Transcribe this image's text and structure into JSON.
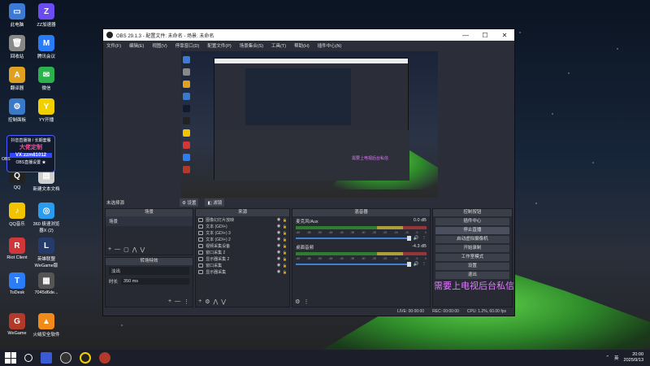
{
  "desktop": {
    "icons": [
      {
        "label": "此电脑",
        "color": "#3b7bd6",
        "glyph": "▭"
      },
      {
        "label": "ZZ加速器",
        "color": "#6b4cf0",
        "glyph": "Z"
      },
      {
        "label": "回收站",
        "color": "#888888",
        "glyph": "🗑"
      },
      {
        "label": "腾讯会议",
        "color": "#2a7cf6",
        "glyph": "M"
      },
      {
        "label": "翻译器",
        "color": "#e0a020",
        "glyph": "A"
      },
      {
        "label": "微信",
        "color": "#2bb24c",
        "glyph": "✉"
      },
      {
        "label": "控制面板",
        "color": "#3a78c8",
        "glyph": "⚙"
      },
      {
        "label": "YY开播",
        "color": "#f0d000",
        "glyph": "Y"
      },
      {
        "label": "QQ",
        "color": "#222222",
        "glyph": "Q"
      },
      {
        "label": "新建文本文档",
        "color": "#cfcfcf",
        "glyph": "▤"
      },
      {
        "label": "QQ音乐",
        "color": "#f2c400",
        "glyph": "♪"
      },
      {
        "label": "360 极速浏览器X (2)",
        "color": "#2a9cf0",
        "glyph": "◎"
      },
      {
        "label": "Riot Client",
        "color": "#d13639",
        "glyph": "R"
      },
      {
        "label": "英雄联盟 WeGame版",
        "color": "#243b6b",
        "glyph": "L"
      },
      {
        "label": "ToDesk",
        "color": "#2b7cf7",
        "glyph": "T"
      },
      {
        "label": "7045d6de...",
        "color": "#555555",
        "glyph": "▦"
      },
      {
        "label": "WeGame",
        "color": "#b33a2a",
        "glyph": "G"
      },
      {
        "label": "火绒安全软件",
        "color": "#f28a1a",
        "glyph": "▲"
      }
    ],
    "promo": {
      "line1": "抖音直播接 / 长期套餐",
      "line2": "大佬定制",
      "vx": "VX:zzm81012",
      "line3": "OBS直播设置 ★"
    },
    "obs_icon_label": "OBS"
  },
  "obs": {
    "title": "OBS 29.1.3 - 配置文件: 未命名 - 场景: 未命名",
    "window_controls": {
      "min": "—",
      "max": "☐",
      "close": "✕"
    },
    "menu": [
      "文件(F)",
      "编辑(E)",
      "视图(V)",
      "停靠窗口(D)",
      "配置文件(P)",
      "场景集合(S)",
      "工具(T)",
      "帮助(H)",
      "插件中心(N)"
    ],
    "preview_overlay_text": "需要上电视后台私信",
    "scene_bar": {
      "label": "未选择源",
      "settings": "⚙ 设置",
      "filters": "◧ 滤镜"
    },
    "docks": {
      "scenes": {
        "title": "场景",
        "items": [
          "场景"
        ],
        "footer": [
          "+",
          "—",
          "▢",
          "⋀",
          "⋁"
        ]
      },
      "transitions": {
        "title": "转场特效",
        "type": "淡出",
        "duration_label": "时长",
        "duration": "350 ms",
        "footer": [
          "+",
          "—",
          "⋮"
        ]
      },
      "sources": {
        "title": "来源",
        "items": [
          "图像幻灯片放映",
          "文本 (GDI+)",
          "文本 (GDI+) 3",
          "文本 (GDI+) 2",
          "视频采集设备",
          "窗口采集 2",
          "显示器采集 2",
          "窗口采集",
          "显示器采集"
        ],
        "footer": [
          "+",
          "⚙",
          "⋀",
          "⋁"
        ]
      },
      "mixer": {
        "title": "混音器",
        "channels": [
          {
            "name": "麦克风/Aux",
            "db": "0.0 dB"
          },
          {
            "name": "桌面音频",
            "db": "-4.3 dB"
          }
        ],
        "scale": [
          "-60",
          "-55",
          "-50",
          "-45",
          "-40",
          "-35",
          "-30",
          "-25",
          "-20",
          "-15",
          "-10",
          "-5",
          "0"
        ]
      },
      "controls": {
        "title": "控制按钮",
        "buttons": [
          "插件中心",
          "停止直播",
          "启动虚拟摄像机",
          "开始录制",
          "工作室模式",
          "设置",
          "退出"
        ]
      }
    },
    "status": {
      "live": "LIVE: 00:00:00",
      "rec": "REC: 00:00:00",
      "cpu": "CPU: 1.2%, 60.00 fps"
    }
  },
  "overlay_text": "需要上电视后台私信",
  "taskbar": {
    "ime": "英",
    "time": "20:00",
    "date": "2025/9/13"
  }
}
